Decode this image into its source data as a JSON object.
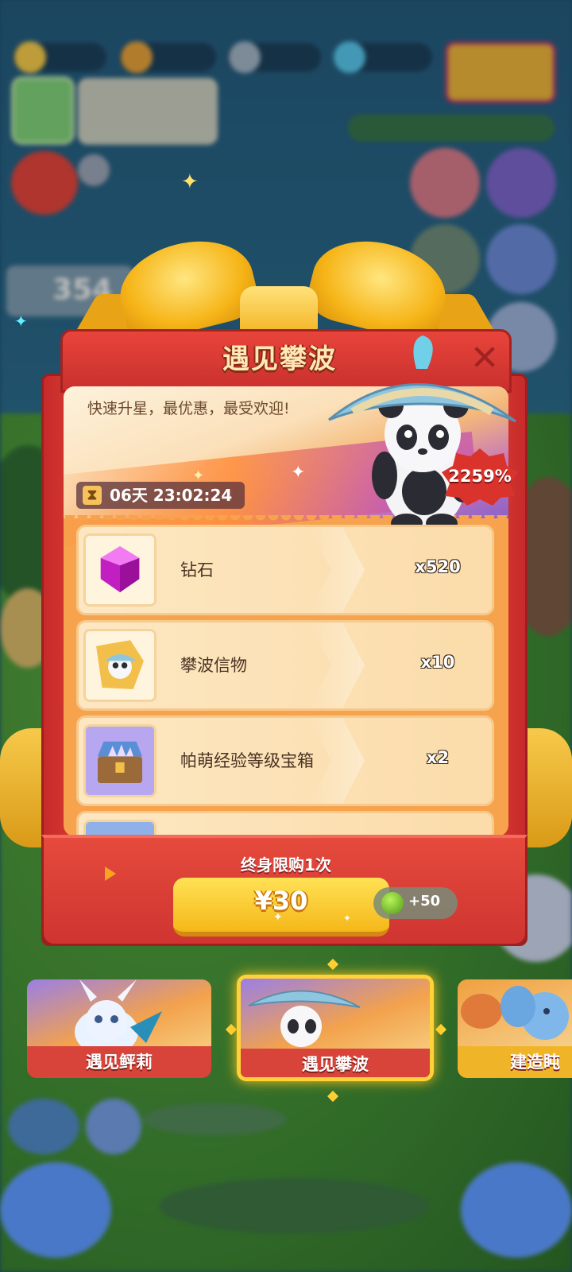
{
  "dialog": {
    "title": "遇见攀波",
    "description": "快速升星，最优惠，最受欢迎!",
    "timer": "06天 23:02:24",
    "discount_badge": "2259%",
    "close_icon": "close-icon",
    "items": [
      {
        "name": "钻石",
        "quantity": "x520",
        "icon": "gem-icon"
      },
      {
        "name": "攀波信物",
        "quantity": "x10",
        "icon": "panda-token-icon"
      },
      {
        "name": "帕萌经验等级宝箱",
        "quantity": "x2",
        "icon": "treasure-chest-icon"
      },
      {
        "name": "",
        "quantity": "",
        "icon": "treasure-chest-icon"
      }
    ],
    "purchase_limit": "终身限购1次",
    "price": "¥30",
    "bonus": "+50"
  },
  "tabs": [
    {
      "label": "遇见鲆莉",
      "selected": false
    },
    {
      "label": "遇见攀波",
      "selected": true
    },
    {
      "label": "建造盹",
      "selected": false
    }
  ],
  "background": {
    "side_counter": "354"
  },
  "colors": {
    "box_red": "#e54438",
    "ribbon_gold": "#f6b518",
    "panel_orange": "#f7a34e",
    "buy_yellow": "#ffe255",
    "tab_red": "#d8433a"
  }
}
